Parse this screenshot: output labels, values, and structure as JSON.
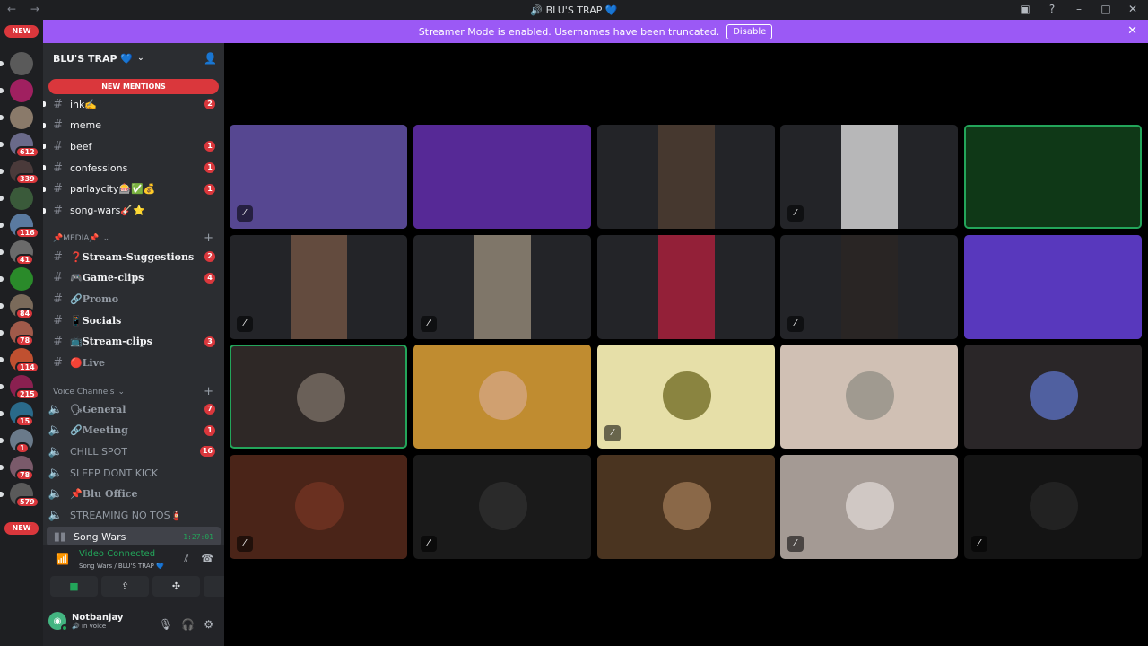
{
  "window": {
    "title": "🔊 BLU'S TRAP 💙",
    "nav": "← →",
    "icons": [
      "inbox-icon",
      "help-icon",
      "minimize-icon",
      "maximize-icon",
      "close-icon"
    ]
  },
  "banner": {
    "text": "Streamer Mode is enabled. Usernames have been truncated.",
    "button": "Disable",
    "close": "✕"
  },
  "servers": {
    "new_top": "NEW",
    "new_bottom": "NEW",
    "badges": [
      "612",
      "339",
      "116",
      "41",
      "84",
      "78",
      "114",
      "215",
      "15",
      "1",
      "78",
      "579"
    ]
  },
  "guild": {
    "name": "BLU'S TRAP 💙",
    "chevron": "⌄",
    "new_mentions": "NEW MENTIONS"
  },
  "channels": [
    {
      "name": "ink✍️",
      "badge": "2",
      "unread": true
    },
    {
      "name": "meme",
      "badge": "",
      "unread": true
    },
    {
      "name": "beef",
      "badge": "1",
      "unread": true
    },
    {
      "name": "confessions",
      "badge": "1",
      "unread": true
    },
    {
      "name": "parlaycity🎰✅💰",
      "badge": "1",
      "unread": true
    },
    {
      "name": "song-wars🎸⭐",
      "badge": "",
      "unread": true
    }
  ],
  "media_category": {
    "label": "📌MEDIA📌",
    "chevron": "⌄",
    "plus": "+"
  },
  "media_channels": [
    {
      "name": "❓Stream-Suggestions",
      "badge": "2"
    },
    {
      "name": "🎮Game-clips",
      "badge": "4"
    },
    {
      "name": "🔗Promo",
      "badge": ""
    },
    {
      "name": "📱Socials",
      "badge": ""
    },
    {
      "name": "📺Stream-clips",
      "badge": "3"
    },
    {
      "name": "🔴Live",
      "badge": ""
    }
  ],
  "voice_category": {
    "label": "Voice Channels",
    "chevron": "⌄",
    "plus": "+"
  },
  "voice_channels": [
    {
      "name": "🗣General",
      "badge": "7"
    },
    {
      "name": "🔗Meeting",
      "badge": "1"
    },
    {
      "name": "CHILL SPOT",
      "badge": "16"
    },
    {
      "name": "SLEEP DONT KICK",
      "badge": ""
    },
    {
      "name": "📌Blu Office",
      "badge": ""
    },
    {
      "name": "STREAMING NO TOS🧯",
      "badge": ""
    },
    {
      "name": "Song Wars",
      "badge": "",
      "timer": "1:27:01"
    }
  ],
  "voice_panel": {
    "status": "Video Connected",
    "sub": "Song Wars / BLU'S TRAP 💙"
  },
  "user": {
    "name": "Notbanjay",
    "status": "🔊 In voice"
  },
  "tiles": [
    {
      "bg": "#2d2a44",
      "vid": "#5b4a9a",
      "muted": true
    },
    {
      "bg": "#3b2070",
      "vid": "#5a2a9a",
      "muted": false
    },
    {
      "bg": "#232428",
      "vid": "#4a3b30",
      "muted": false
    },
    {
      "bg": "#232428",
      "vid": "#c8c8c8",
      "muted": true
    },
    {
      "bg": "#0a2a10",
      "vid": "#0f3a18",
      "muted": false,
      "speaking": true
    },
    {
      "bg": "#232428",
      "vid": "#6a5040",
      "muted": true
    },
    {
      "bg": "#232428",
      "vid": "#8a8070",
      "muted": true
    },
    {
      "bg": "#232428",
      "vid": "#a0203a",
      "muted": false
    },
    {
      "bg": "#232428",
      "vid": "#2a2624",
      "muted": true
    },
    {
      "bg": "#4a2aa0",
      "vid": "#5a3ac0",
      "muted": false
    },
    {
      "bg": "#2e2826",
      "av": "#6a6058",
      "muted": false,
      "speaking": true
    },
    {
      "bg": "#c08c30",
      "av": "#d0a070",
      "muted": false
    },
    {
      "bg": "#e6dfa8",
      "av": "#8a8440",
      "muted": true
    },
    {
      "bg": "#d0c0b4",
      "av": "#a09a90",
      "muted": false
    },
    {
      "bg": "#2a2628",
      "av": "#5060a0",
      "muted": false
    },
    {
      "bg": "#4a2418",
      "av": "#6a3020",
      "muted": true
    },
    {
      "bg": "#1a1a1a",
      "av": "#2a2a2a",
      "muted": true
    },
    {
      "bg": "#4a3420",
      "av": "#8a6848",
      "muted": false
    },
    {
      "bg": "#a49a94",
      "av": "#d0c8c4",
      "muted": true
    },
    {
      "bg": "#141414",
      "av": "#222",
      "muted": true
    }
  ]
}
